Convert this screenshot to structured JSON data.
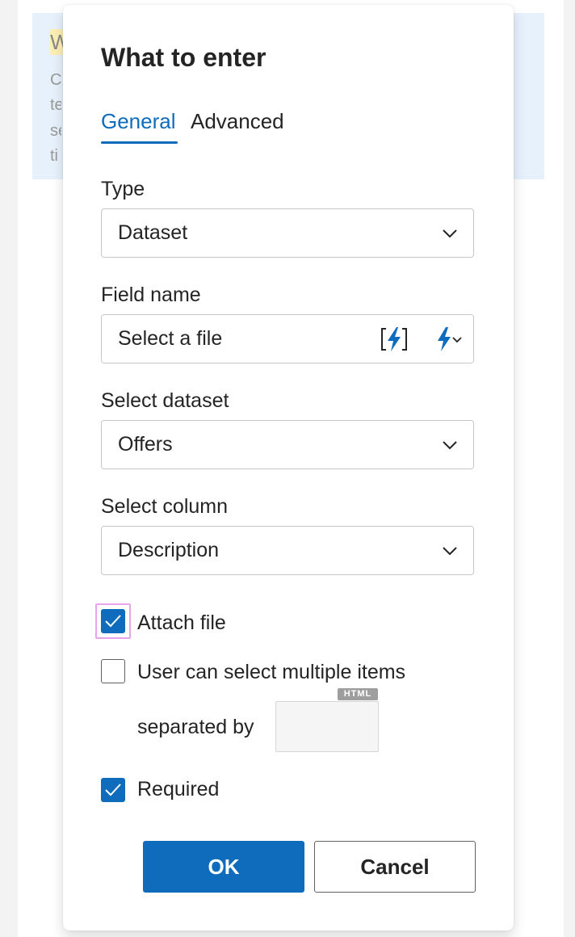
{
  "dialog": {
    "title": "What to enter",
    "tabs": [
      {
        "label": "General",
        "active": true
      },
      {
        "label": "Advanced",
        "active": false
      }
    ],
    "type": {
      "label": "Type",
      "value": "Dataset"
    },
    "field_name": {
      "label": "Field name",
      "value": "Select a file"
    },
    "dataset": {
      "label": "Select dataset",
      "value": "Offers"
    },
    "column": {
      "label": "Select column",
      "value": "Description"
    },
    "checkboxes": {
      "attach_file": {
        "label": "Attach file",
        "checked": true
      },
      "multiple": {
        "label": "User can select multiple items",
        "checked": false
      },
      "required": {
        "label": "Required",
        "checked": true
      }
    },
    "separator": {
      "label": "separated by",
      "value": "",
      "badge": "HTML"
    },
    "buttons": {
      "ok": "OK",
      "cancel": "Cancel"
    }
  },
  "icons": {
    "field_macro": "insert-macro-bracket-bolt-icon",
    "field_macro_menu": "bolt-dropdown-icon",
    "chevron": "chevron-down-icon",
    "check": "checkmark-icon"
  },
  "colors": {
    "accent": "#0f6cbd",
    "focus_ring": "#e9a3ec",
    "background_card": "#e6f1fb"
  },
  "background": {
    "title_fragment": "W",
    "line_fragments": [
      "C",
      "te",
      "se",
      "ti"
    ]
  }
}
